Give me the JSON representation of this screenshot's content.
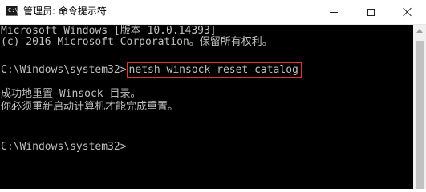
{
  "window": {
    "title": "管理员: 命令提示符",
    "icon": "cmd-icon",
    "icon_prompt": "C:\\"
  },
  "titlebar_buttons": {
    "minimize": "minimize-icon",
    "maximize": "maximize-icon",
    "close": "close-icon"
  },
  "console": {
    "lines": [
      "Microsoft Windows [版本 10.0.14393]",
      "(c) 2016 Microsoft Corporation。保留所有权利。",
      "",
      "成功地重置 Winsock 目录。",
      "你必须重新启动计算机才能完成重置。",
      "C:\\Windows\\system32>"
    ],
    "prompt": "C:\\Windows\\system32>",
    "command": "netsh winsock reset catalog"
  },
  "colors": {
    "console_background": "#000000",
    "console_text": "#c0c0c0",
    "highlight_border": "#e0352b",
    "titlebar_background": "#ffffff"
  }
}
